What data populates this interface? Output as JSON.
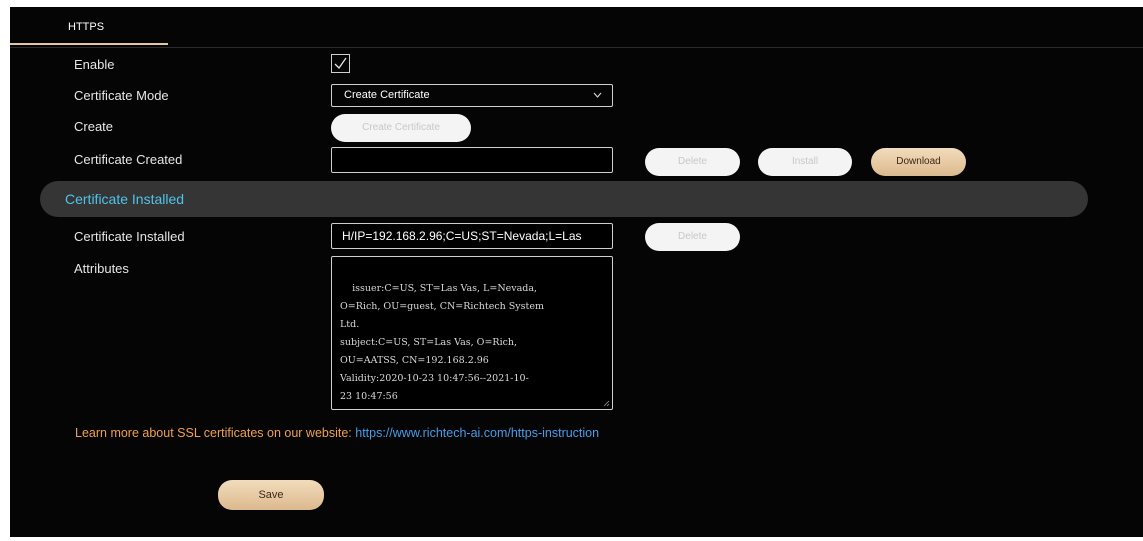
{
  "tab": {
    "label": "HTTPS"
  },
  "enable": {
    "label": "Enable",
    "checked": true
  },
  "certificate_mode": {
    "label": "Certificate Mode",
    "selected": "Create Certificate"
  },
  "create": {
    "label": "Create",
    "button": "Create Certificate"
  },
  "certificate_created": {
    "label": "Certificate Created",
    "value": "",
    "delete_button": "Delete",
    "install_button": "Install",
    "download_button": "Download"
  },
  "installed_section": {
    "title": "Certificate Installed"
  },
  "certificate_installed": {
    "label": "Certificate Installed",
    "value": "H/IP=192.168.2.96;C=US;ST=Nevada;L=Las",
    "delete_button": "Delete"
  },
  "attributes": {
    "label": "Attributes",
    "value": "issuer:C=US, ST=Las Vas, L=Nevada,\nO=Rich, OU=guest, CN=Richtech System\nLtd.\nsubject:C=US, ST=Las Vas, O=Rich,\nOU=AATSS, CN=192.168.2.96\nValidity:2020-10-23 10:47:56--2021-10-\n23 10:47:56"
  },
  "learn_more": {
    "text": "Learn more about SSL certificates on our website: ",
    "link": "https://www.richtech-ai.com/https-instruction"
  },
  "save_button": "Save",
  "colors": {
    "accent_gold": "#e3c79f",
    "section_title": "#4fc3ea",
    "learn_text": "#f0a050",
    "link": "#4a9be8",
    "background": "#050505"
  }
}
